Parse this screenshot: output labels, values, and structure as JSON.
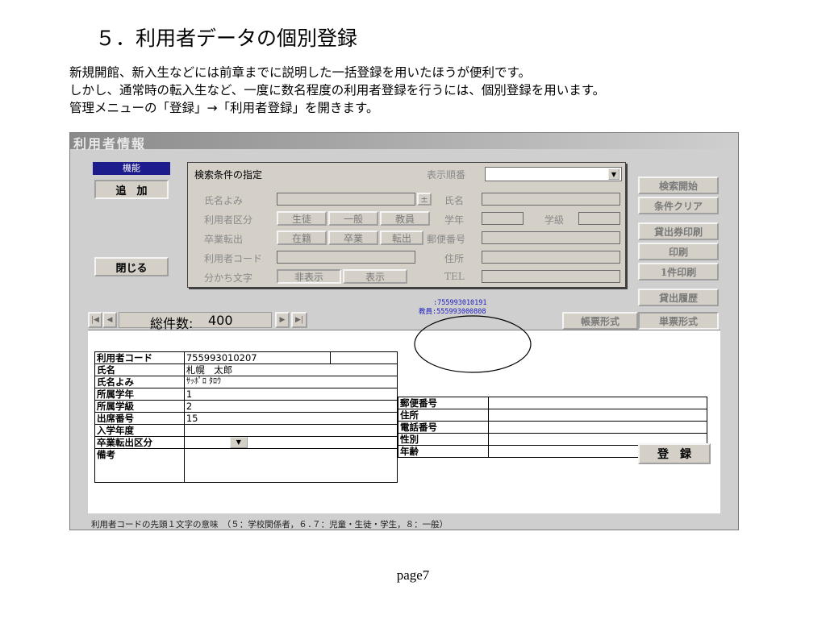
{
  "slide": {
    "title": "５．利用者データの個別登録",
    "intro_lines": [
      "新規開館、新入生などには前章までに説明した一括登録を用いたほうが便利です。",
      "しかし、通常時の転入生など、一度に数名程度の利用者登録を行うには、個別登録を用います。",
      "管理メニューの「登録」→「利用者登録」を開きます。"
    ],
    "page_label": "page7"
  },
  "window": {
    "title": "利用者情報",
    "function_panel": {
      "header": "機能",
      "add_label": "追　加",
      "close_label": "閉じる"
    },
    "search": {
      "title": "検索条件の指定",
      "sort_label": "表示順番",
      "name_kana_label": "氏名よみ",
      "plus_label": "±",
      "name_label": "氏名",
      "category_label": "利用者区分",
      "category_options": [
        "生徒",
        "一般",
        "教員"
      ],
      "grade_label": "学年",
      "class_label": "学級",
      "transfer_label": "卒業転出",
      "transfer_options": [
        "在籍",
        "卒業",
        "転出"
      ],
      "postal_label": "郵便番号",
      "code_label": "利用者コード",
      "address_label": "住所",
      "separator_label": "分かち文字",
      "separator_options": [
        "非表示",
        "表示"
      ],
      "tel_label": "TEL"
    },
    "right_buttons": {
      "search_start": "検索開始",
      "clear": "条件クリア",
      "print_card": "貸出券印刷",
      "print": "印刷",
      "print_one": "1件印刷",
      "history": "貸出履歴",
      "list_form": "帳票形式",
      "single_form": "単票形式"
    },
    "nav": {
      "first": "|◀",
      "prev": "◀",
      "total_label": "総件数:",
      "total_value": "400",
      "next": "▶",
      "last": "▶|"
    },
    "barcode_text": {
      "line1": ":755993010191",
      "line2": "教員:555993000808"
    },
    "record": {
      "user_code_label": "利用者コード",
      "user_code": "755993010207",
      "name_label": "氏名",
      "name": "札幌　太郎",
      "name_kana_label": "氏名よみ",
      "name_kana": "ｻｯﾎﾟﾛ ﾀﾛｳ",
      "grade_label": "所属学年",
      "grade": "1",
      "class_label": "所属学級",
      "class": "2",
      "attendance_label": "出席番号",
      "attendance": "15",
      "entry_year_label": "入学年度",
      "entry_year": "",
      "transfer_label": "卒業転出区分",
      "transfer": "",
      "note_label": "備考",
      "note": "",
      "postal_label": "郵便番号",
      "address_label": "住所",
      "phone_label": "電話番号",
      "gender_label": "性別",
      "age_label": "年齢",
      "register_label": "登　録"
    },
    "footer_note": "利用者コードの先頭１文字の意味　（５：学校関係者，６.７：児童・生徒・学生，８：一般）"
  }
}
